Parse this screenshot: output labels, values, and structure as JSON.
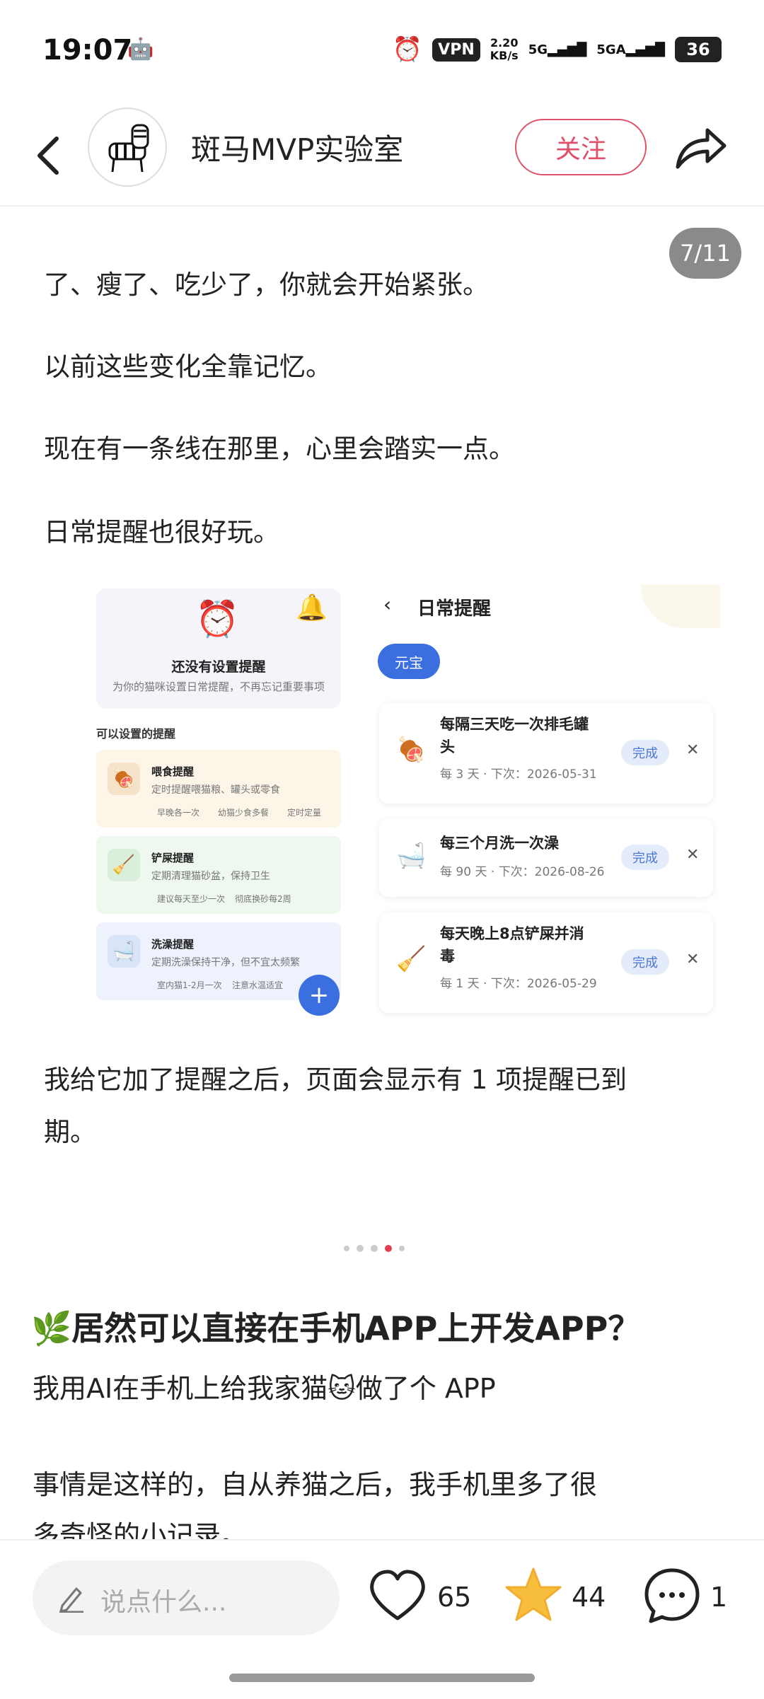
{
  "status_bar": {
    "time": "19:07",
    "vpn": "VPN",
    "speed_value": "2.20",
    "speed_unit": "KB/s",
    "sig1": "5G",
    "sig2": "5GA",
    "battery": "36"
  },
  "header": {
    "account_name": "斑马MVP实验室",
    "follow_label": "关注"
  },
  "page_counter": "7/11",
  "paragraphs": [
    "了、瘦了、吃少了，你就会开始紧张。",
    "以前这些变化全靠记忆。",
    "现在有一条线在那里，心里会踏实一点。",
    "日常提醒也很好玩。"
  ],
  "embedded_left": {
    "empty_title": "还没有设置提醒",
    "empty_sub": "为你的猫咪设置日常提醒，不再忘记重要事项",
    "section_label": "可以设置的提醒",
    "cards": [
      {
        "title": "喂食提醒",
        "desc": "定时提醒喂猫粮、罐头或零食",
        "tags": [
          "早晚各一次",
          "幼猫少食多餐",
          "定时定量"
        ]
      },
      {
        "title": "铲屎提醒",
        "desc": "定期清理猫砂盆，保持卫生",
        "tags": [
          "建议每天至少一次",
          "彻底换砂每2周"
        ]
      },
      {
        "title": "洗澡提醒",
        "desc": "定期洗澡保持干净，但不宜太频繁",
        "tags": [
          "室内猫1-2月一次",
          "注意水温适宜"
        ]
      }
    ],
    "fab": "+"
  },
  "embedded_right": {
    "title": "日常提醒",
    "pet_chip": "元宝",
    "reminders": [
      {
        "title_l1": "每隔三天吃一次排毛罐",
        "title_l2": "头",
        "meta": "每 3 天 · 下次：2026-05-31"
      },
      {
        "title_l1": "每三个月洗一次澡",
        "title_l2": "",
        "meta": "每 90 天 · 下次：2026-08-26"
      },
      {
        "title_l1": "每天晚上8点铲屎并消",
        "title_l2": "毒",
        "meta": "每 1 天 · 下次：2026-05-29"
      }
    ],
    "done_label": "完成",
    "close_glyph": "✕"
  },
  "after_text_l1": "我给它加了提醒之后，页面会显示有 1 项提醒已到",
  "after_text_l2": "期。",
  "post": {
    "title": "🌿居然可以直接在手机APP上开发APP？",
    "subtitle": "我用AI在手机上给我家猫🐱做了个 APP",
    "body_l1": "事情是这样的，自从养猫之后，我手机里多了很",
    "body_l2": "多奇怪的小记录。"
  },
  "bottom_bar": {
    "comment_placeholder": "说点什么...",
    "like_count": "65",
    "star_count": "44",
    "comment_count": "1"
  }
}
